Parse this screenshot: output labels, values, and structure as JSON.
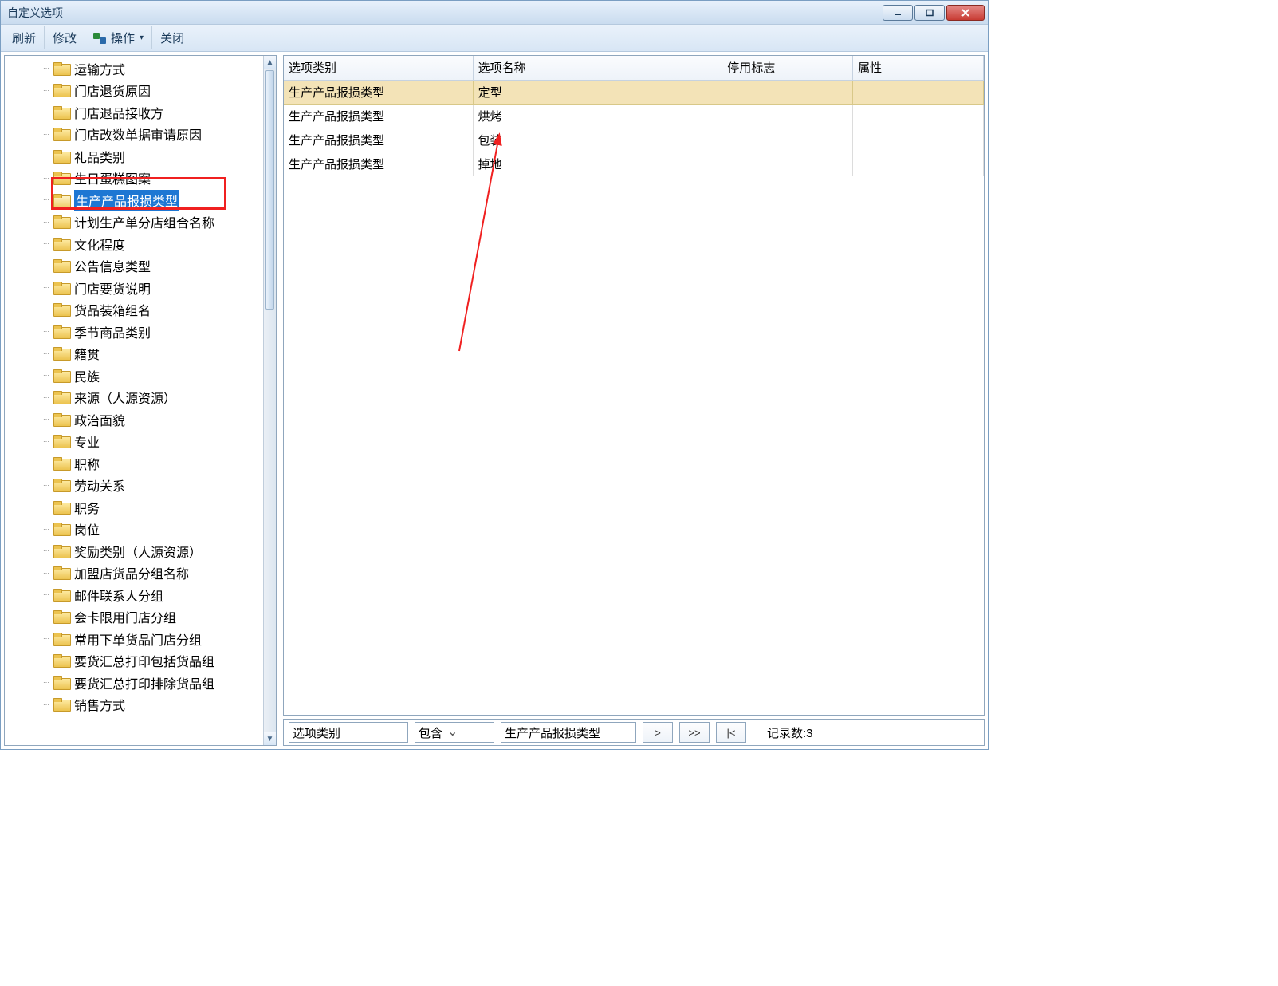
{
  "window": {
    "title": "自定义选项"
  },
  "toolbar": {
    "refresh": "刷新",
    "modify": "修改",
    "operate": "操作",
    "close": "关闭"
  },
  "tree": {
    "selectedIndex": 6,
    "items": [
      "运输方式",
      "门店退货原因",
      "门店退品接收方",
      "门店改数单据审请原因",
      "礼品类别",
      "生日蛋糕图案",
      "生产产品报损类型",
      "计划生产单分店组合名称",
      "文化程度",
      "公告信息类型",
      "门店要货说明",
      "货品装箱组名",
      "季节商品类别",
      "籍贯",
      "民族",
      "来源（人源资源）",
      "政治面貌",
      "专业",
      "职称",
      "劳动关系",
      "职务",
      "岗位",
      "奖励类别（人源资源）",
      "加盟店货品分组名称",
      "邮件联系人分组",
      "会卡限用门店分组",
      "常用下单货品门店分组",
      "要货汇总打印包括货品组",
      "要货汇总打印排除货品组",
      "销售方式"
    ]
  },
  "grid": {
    "columns": [
      "选项类别",
      "选项名称",
      "停用标志",
      "属性"
    ],
    "rows": [
      {
        "category": "生产产品报损类型",
        "name": "定型",
        "disabled": "",
        "attr": "",
        "selected": true
      },
      {
        "category": "生产产品报损类型",
        "name": "烘烤",
        "disabled": "",
        "attr": "",
        "selected": false
      },
      {
        "category": "生产产品报损类型",
        "name": "包装",
        "disabled": "",
        "attr": "",
        "selected": false
      },
      {
        "category": "生产产品报损类型",
        "name": "掉地",
        "disabled": "",
        "attr": "",
        "selected": false
      }
    ]
  },
  "filter": {
    "field": "选项类别",
    "op": "包含",
    "value": "生产产品报损类型",
    "nav_next": ">",
    "nav_last": ">>",
    "nav_first": "|<",
    "count_label": "记录数:3"
  }
}
